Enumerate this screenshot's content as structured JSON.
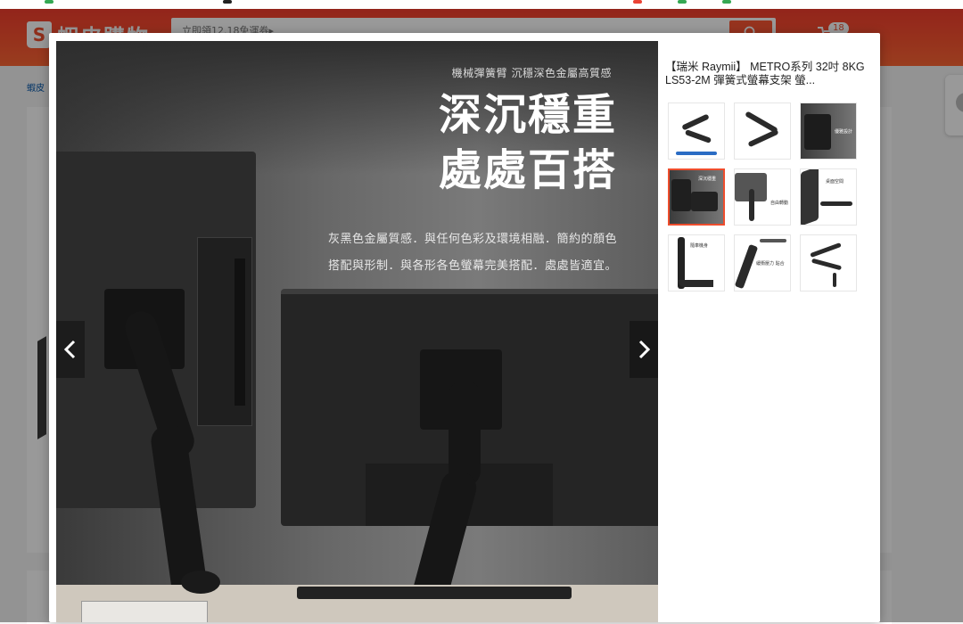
{
  "header": {
    "logo_text": "蝦皮購物",
    "search_placeholder": "立即領12.18免運券▸",
    "cart_count": "18"
  },
  "breadcrumb": "蝦皮",
  "modal": {
    "product_title": "【瑞米 Raymii】 METRO系列 32吋 8KG LS53-2M 彈簧式螢幕支架 螢...",
    "image": {
      "subtitle": "機械彈簧臂 沉穩深色金屬高質感",
      "headline_line1": "深沉穩重",
      "headline_line2": "處處百搭",
      "desc_line1": "灰黑色金屬質感．與任何色彩及環境相融．簡約的顏色",
      "desc_line2": "搭配與形制．與各形各色螢幕完美搭配．處處皆適宜。"
    },
    "thumbnails": [
      {
        "label": ""
      },
      {
        "label": ""
      },
      {
        "label": "優雅設計"
      },
      {
        "label": "深沉穩重"
      },
      {
        "label": "自由轉動"
      },
      {
        "label": "桌面空間"
      },
      {
        "label": "隨車機身"
      },
      {
        "label": "緩衝壓力 貼合"
      },
      {
        "label": ""
      }
    ],
    "active_thumbnail": 4
  },
  "colors": {
    "shopee_orange": "#ee4d2d",
    "active_border": "#ee4d2d"
  }
}
